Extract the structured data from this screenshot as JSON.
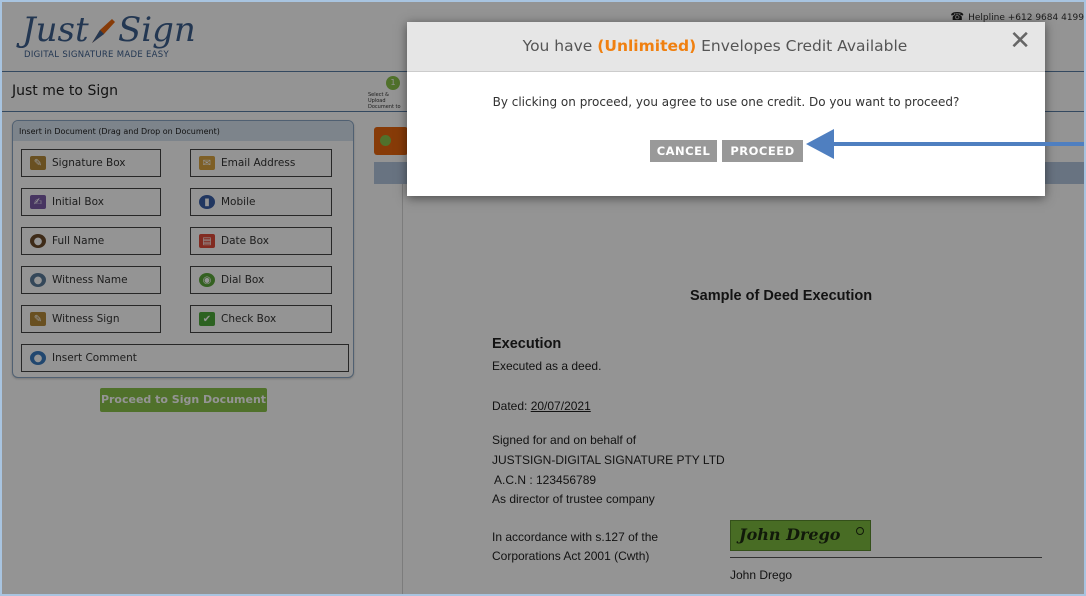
{
  "app": {
    "logo_part1": "Just",
    "logo_part2": "Sign",
    "tagline": "DIGITAL SIGNATURE MADE EASY",
    "helpline": "Helpline +612 9684 4199",
    "phone_icon": "phone-icon"
  },
  "titlebar": {
    "page_title": "Just me to Sign",
    "step1_number": "1",
    "step1_label": "Select & Upload Document to"
  },
  "left_panel": {
    "heading": "Insert in Document (Drag and Drop on Document)",
    "fields": [
      {
        "label": "Signature Box",
        "icon": "signature-icon"
      },
      {
        "label": "Email Address",
        "icon": "envelope-icon"
      },
      {
        "label": "Initial Box",
        "icon": "initials-icon"
      },
      {
        "label": "Mobile",
        "icon": "mobile-icon"
      },
      {
        "label": "Full Name",
        "icon": "person-icon"
      },
      {
        "label": "Date Box",
        "icon": "calendar-icon"
      },
      {
        "label": "Witness Name",
        "icon": "witness-icon"
      },
      {
        "label": "Dial Box",
        "icon": "dial-icon"
      },
      {
        "label": "Witness Sign",
        "icon": "witness-sign-icon"
      },
      {
        "label": "Check Box",
        "icon": "checkbox-icon"
      },
      {
        "label": "Insert Comment",
        "icon": "comment-icon"
      }
    ],
    "proceed_button": "Proceed to Sign Document"
  },
  "document": {
    "title": "Sample of Deed Execution",
    "heading": "Execution",
    "line1": "Executed as a deed.",
    "dated_label": "Dated:",
    "dated_value": "20/07/2021",
    "signed_line1": "Signed for and on behalf of",
    "signed_line2": "JUSTSIGN-DIGITAL SIGNATURE PTY LTD",
    "signed_line3": "A.C.N : 123456789",
    "signed_line4": "As director of trustee company",
    "accord_line1": "In accordance with s.127 of the",
    "accord_line2": "Corporations Act 2001 (Cwth)",
    "signature_text": "John Drego",
    "signer_name": "John Drego"
  },
  "modal": {
    "title_before": "You have",
    "title_highlight": "(Unlimited)",
    "title_after": "Envelopes Credit Available",
    "close_symbol": "✕",
    "message": "By clicking on proceed, you agree to use one credit. Do you want to proceed?",
    "cancel_label": "CANCEL",
    "proceed_label": "PROCEED"
  },
  "colors": {
    "brand_blue": "#3d5f8e",
    "accent_orange": "#f08010",
    "green": "#8bc34a",
    "arrow_blue": "#4f7fc0"
  }
}
